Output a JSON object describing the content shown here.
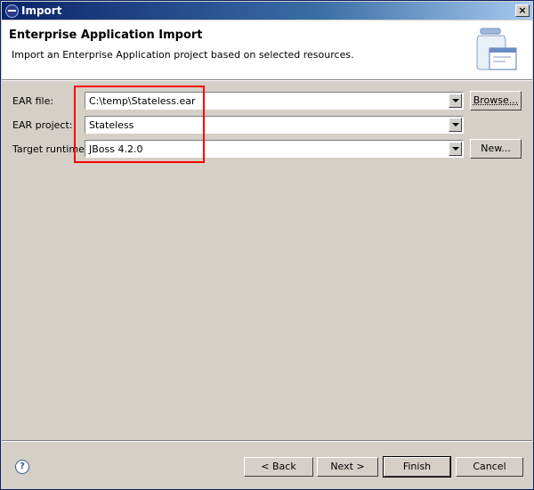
{
  "window": {
    "title": "Import",
    "close_glyph": "×"
  },
  "banner": {
    "title": "Enterprise Application Import",
    "description": "Import an Enterprise Application project based on selected resources.",
    "graphic_icon": "jar-wizard-icon"
  },
  "form": {
    "ear_file": {
      "label": "EAR file:",
      "value": "C:\\temp\\Stateless.ear",
      "button": "Browse..."
    },
    "ear_project": {
      "label": "EAR project:",
      "value": "Stateless"
    },
    "target_runtime": {
      "label": "Target runtime:",
      "value": "JBoss 4.2.0",
      "button": "New..."
    }
  },
  "footer": {
    "help_glyph": "?",
    "back": "< Back",
    "next": "Next >",
    "finish": "Finish",
    "cancel": "Cancel"
  },
  "colors": {
    "highlight": "#ff0000",
    "title_bar": "#0a246a",
    "dialog_bg": "#d4d0c8"
  }
}
